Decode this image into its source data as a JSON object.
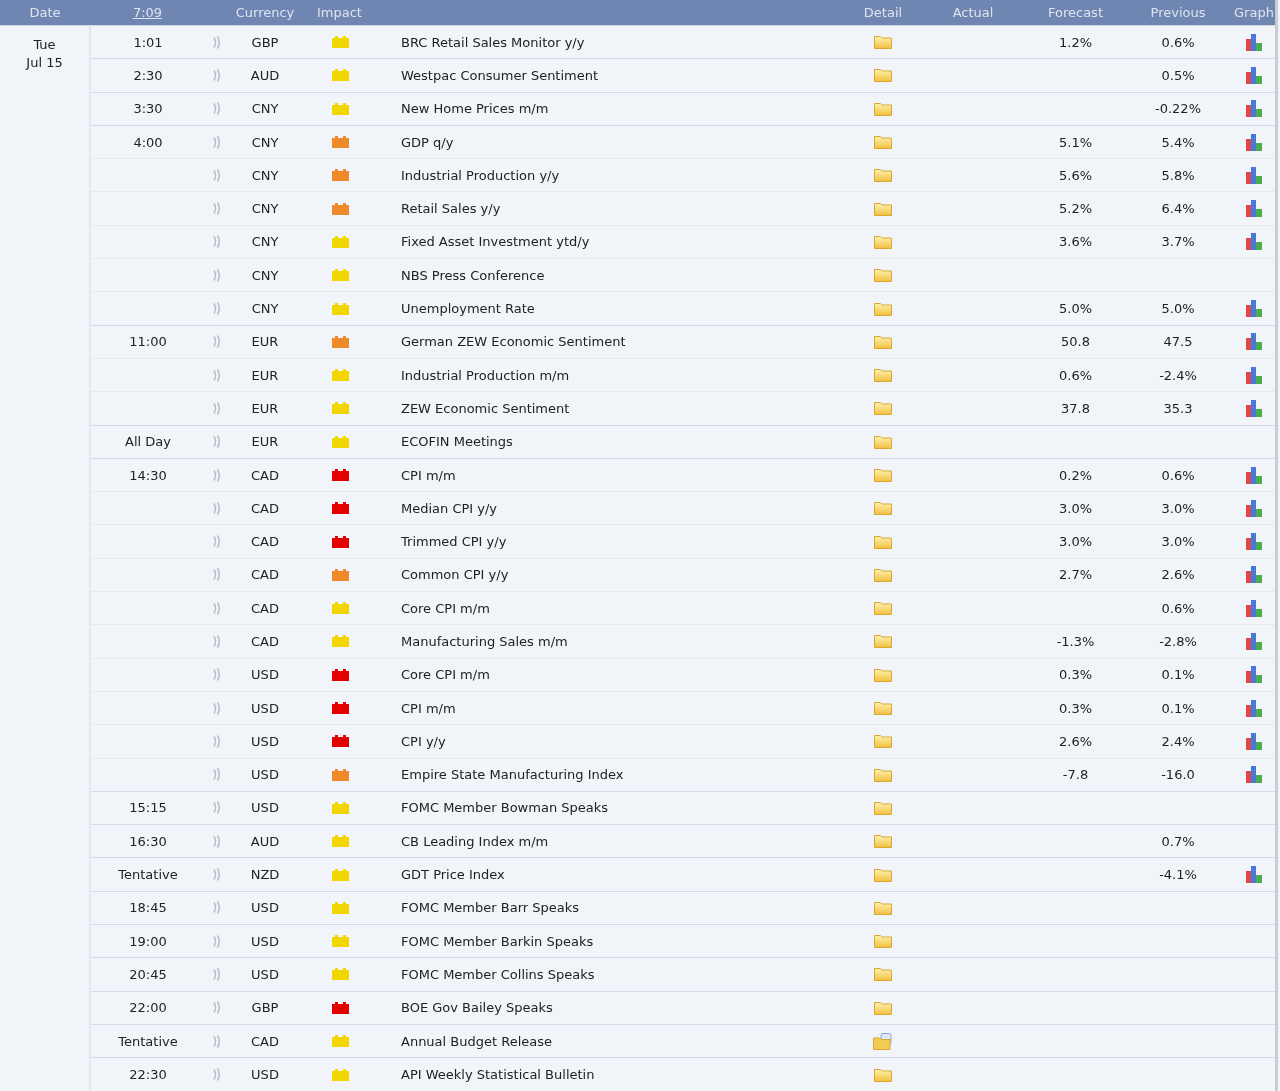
{
  "header": {
    "date": "Date",
    "time": "7:09",
    "currency": "Currency",
    "impact": "Impact",
    "detail": "Detail",
    "actual": "Actual",
    "forecast": "Forecast",
    "previous": "Previous",
    "graph": "Graph"
  },
  "date": {
    "weekday": "Tue",
    "day": "Jul 15"
  },
  "groups": [
    {
      "time": "1:01",
      "events": [
        {
          "currency": "GBP",
          "color": "#f2d600",
          "title": "BRC Retail Sales Monitor y/y",
          "detail": {
            "kind": "folder"
          },
          "forecast": "1.2%",
          "previous": "0.6%",
          "graph": true
        }
      ]
    },
    {
      "time": "2:30",
      "events": [
        {
          "currency": "AUD",
          "color": "#f2d600",
          "title": "Westpac Consumer Sentiment",
          "detail": {
            "kind": "folder"
          },
          "previous": "0.5%",
          "graph": true
        }
      ]
    },
    {
      "time": "3:30",
      "events": [
        {
          "currency": "CNY",
          "color": "#f2d600",
          "title": "New Home Prices m/m",
          "detail": {
            "kind": "folder"
          },
          "previous": "-0.22%",
          "graph": true
        }
      ]
    },
    {
      "time": "4:00",
      "events": [
        {
          "currency": "CNY",
          "color": "#ef8a2a",
          "title": "GDP q/y",
          "detail": {
            "kind": "folder"
          },
          "forecast": "5.1%",
          "previous": "5.4%",
          "graph": true
        },
        {
          "currency": "CNY",
          "color": "#ef8a2a",
          "title": "Industrial Production y/y",
          "detail": {
            "kind": "folder"
          },
          "forecast": "5.6%",
          "previous": "5.8%",
          "graph": true
        },
        {
          "currency": "CNY",
          "color": "#ef8a2a",
          "title": "Retail Sales y/y",
          "detail": {
            "kind": "folder"
          },
          "forecast": "5.2%",
          "previous": "6.4%",
          "graph": true
        },
        {
          "currency": "CNY",
          "color": "#f2d600",
          "title": "Fixed Asset Investment ytd/y",
          "detail": {
            "kind": "folder"
          },
          "forecast": "3.6%",
          "previous": "3.7%",
          "graph": true
        },
        {
          "currency": "CNY",
          "color": "#f2d600",
          "title": "NBS Press Conference",
          "detail": {
            "kind": "folder"
          },
          "graph": false
        },
        {
          "currency": "CNY",
          "color": "#f2d600",
          "title": "Unemployment Rate",
          "detail": {
            "kind": "folder"
          },
          "forecast": "5.0%",
          "previous": "5.0%",
          "graph": true
        }
      ]
    },
    {
      "time": "11:00",
      "events": [
        {
          "currency": "EUR",
          "color": "#ef8a2a",
          "title": "German ZEW Economic Sentiment",
          "detail": {
            "kind": "folder"
          },
          "forecast": "50.8",
          "previous": "47.5",
          "graph": true
        },
        {
          "currency": "EUR",
          "color": "#f2d600",
          "title": "Industrial Production m/m",
          "detail": {
            "kind": "folder"
          },
          "forecast": "0.6%",
          "previous": "-2.4%",
          "graph": true
        },
        {
          "currency": "EUR",
          "color": "#f2d600",
          "title": "ZEW Economic Sentiment",
          "detail": {
            "kind": "folder"
          },
          "forecast": "37.8",
          "previous": "35.3",
          "graph": true
        }
      ]
    },
    {
      "time": "All Day",
      "events": [
        {
          "currency": "EUR",
          "color": "#f2d600",
          "title": "ECOFIN Meetings",
          "detail": {
            "kind": "folder"
          },
          "graph": false
        }
      ]
    },
    {
      "time": "14:30",
      "events": [
        {
          "currency": "CAD",
          "color": "#e30000",
          "title": "CPI m/m",
          "detail": {
            "kind": "folder"
          },
          "forecast": "0.2%",
          "previous": "0.6%",
          "graph": true
        },
        {
          "currency": "CAD",
          "color": "#e30000",
          "title": "Median CPI y/y",
          "detail": {
            "kind": "folder"
          },
          "forecast": "3.0%",
          "previous": "3.0%",
          "graph": true
        },
        {
          "currency": "CAD",
          "color": "#e30000",
          "title": "Trimmed CPI y/y",
          "detail": {
            "kind": "folder"
          },
          "forecast": "3.0%",
          "previous": "3.0%",
          "graph": true
        },
        {
          "currency": "CAD",
          "color": "#ef8a2a",
          "title": "Common CPI y/y",
          "detail": {
            "kind": "folder"
          },
          "forecast": "2.7%",
          "previous": "2.6%",
          "graph": true
        },
        {
          "currency": "CAD",
          "color": "#f2d600",
          "title": "Core CPI m/m",
          "detail": {
            "kind": "folder"
          },
          "previous": "0.6%",
          "graph": true
        },
        {
          "currency": "CAD",
          "color": "#f2d600",
          "title": "Manufacturing Sales m/m",
          "detail": {
            "kind": "folder"
          },
          "forecast": "-1.3%",
          "previous": "-2.8%",
          "graph": true
        },
        {
          "currency": "USD",
          "color": "#e30000",
          "title": "Core CPI m/m",
          "detail": {
            "kind": "folder"
          },
          "forecast": "0.3%",
          "previous": "0.1%",
          "graph": true
        },
        {
          "currency": "USD",
          "color": "#e30000",
          "title": "CPI m/m",
          "detail": {
            "kind": "folder"
          },
          "forecast": "0.3%",
          "previous": "0.1%",
          "graph": true
        },
        {
          "currency": "USD",
          "color": "#e30000",
          "title": "CPI y/y",
          "detail": {
            "kind": "folder"
          },
          "forecast": "2.6%",
          "previous": "2.4%",
          "graph": true
        },
        {
          "currency": "USD",
          "color": "#ef8a2a",
          "title": "Empire State Manufacturing Index",
          "detail": {
            "kind": "folder"
          },
          "forecast": "-7.8",
          "previous": "-16.0",
          "graph": true
        }
      ]
    },
    {
      "time": "15:15",
      "events": [
        {
          "currency": "USD",
          "color": "#f2d600",
          "title": "FOMC Member Bowman Speaks",
          "detail": {
            "kind": "folder"
          },
          "graph": false
        }
      ]
    },
    {
      "time": "16:30",
      "events": [
        {
          "currency": "AUD",
          "color": "#f2d600",
          "title": "CB Leading Index m/m",
          "detail": {
            "kind": "folder"
          },
          "previous": "0.7%",
          "graph": false
        }
      ]
    },
    {
      "time": "Tentative",
      "events": [
        {
          "currency": "NZD",
          "color": "#f2d600",
          "title": "GDT Price Index",
          "detail": {
            "kind": "folder"
          },
          "previous": "-4.1%",
          "graph": true
        }
      ]
    },
    {
      "time": "18:45",
      "events": [
        {
          "currency": "USD",
          "color": "#f2d600",
          "title": "FOMC Member Barr Speaks",
          "detail": {
            "kind": "folder"
          },
          "graph": false
        }
      ]
    },
    {
      "time": "19:00",
      "events": [
        {
          "currency": "USD",
          "color": "#f2d600",
          "title": "FOMC Member Barkin Speaks",
          "detail": {
            "kind": "folder"
          },
          "graph": false
        }
      ]
    },
    {
      "time": "20:45",
      "events": [
        {
          "currency": "USD",
          "color": "#f2d600",
          "title": "FOMC Member Collins Speaks",
          "detail": {
            "kind": "folder"
          },
          "graph": false
        }
      ]
    },
    {
      "time": "22:00",
      "events": [
        {
          "currency": "GBP",
          "color": "#e30000",
          "title": "BOE Gov Bailey Speaks",
          "detail": {
            "kind": "folder"
          },
          "graph": false
        }
      ]
    },
    {
      "time": "Tentative",
      "events": [
        {
          "currency": "CAD",
          "color": "#f2d600",
          "title": "Annual Budget Release",
          "detail": {
            "kind": "folder-doc"
          },
          "graph": false
        }
      ]
    },
    {
      "time": "22:30",
      "events": [
        {
          "currency": "USD",
          "color": "#f2d600",
          "title": "API Weekly Statistical Bulletin",
          "detail": {
            "kind": "folder"
          },
          "graph": false
        }
      ]
    }
  ]
}
